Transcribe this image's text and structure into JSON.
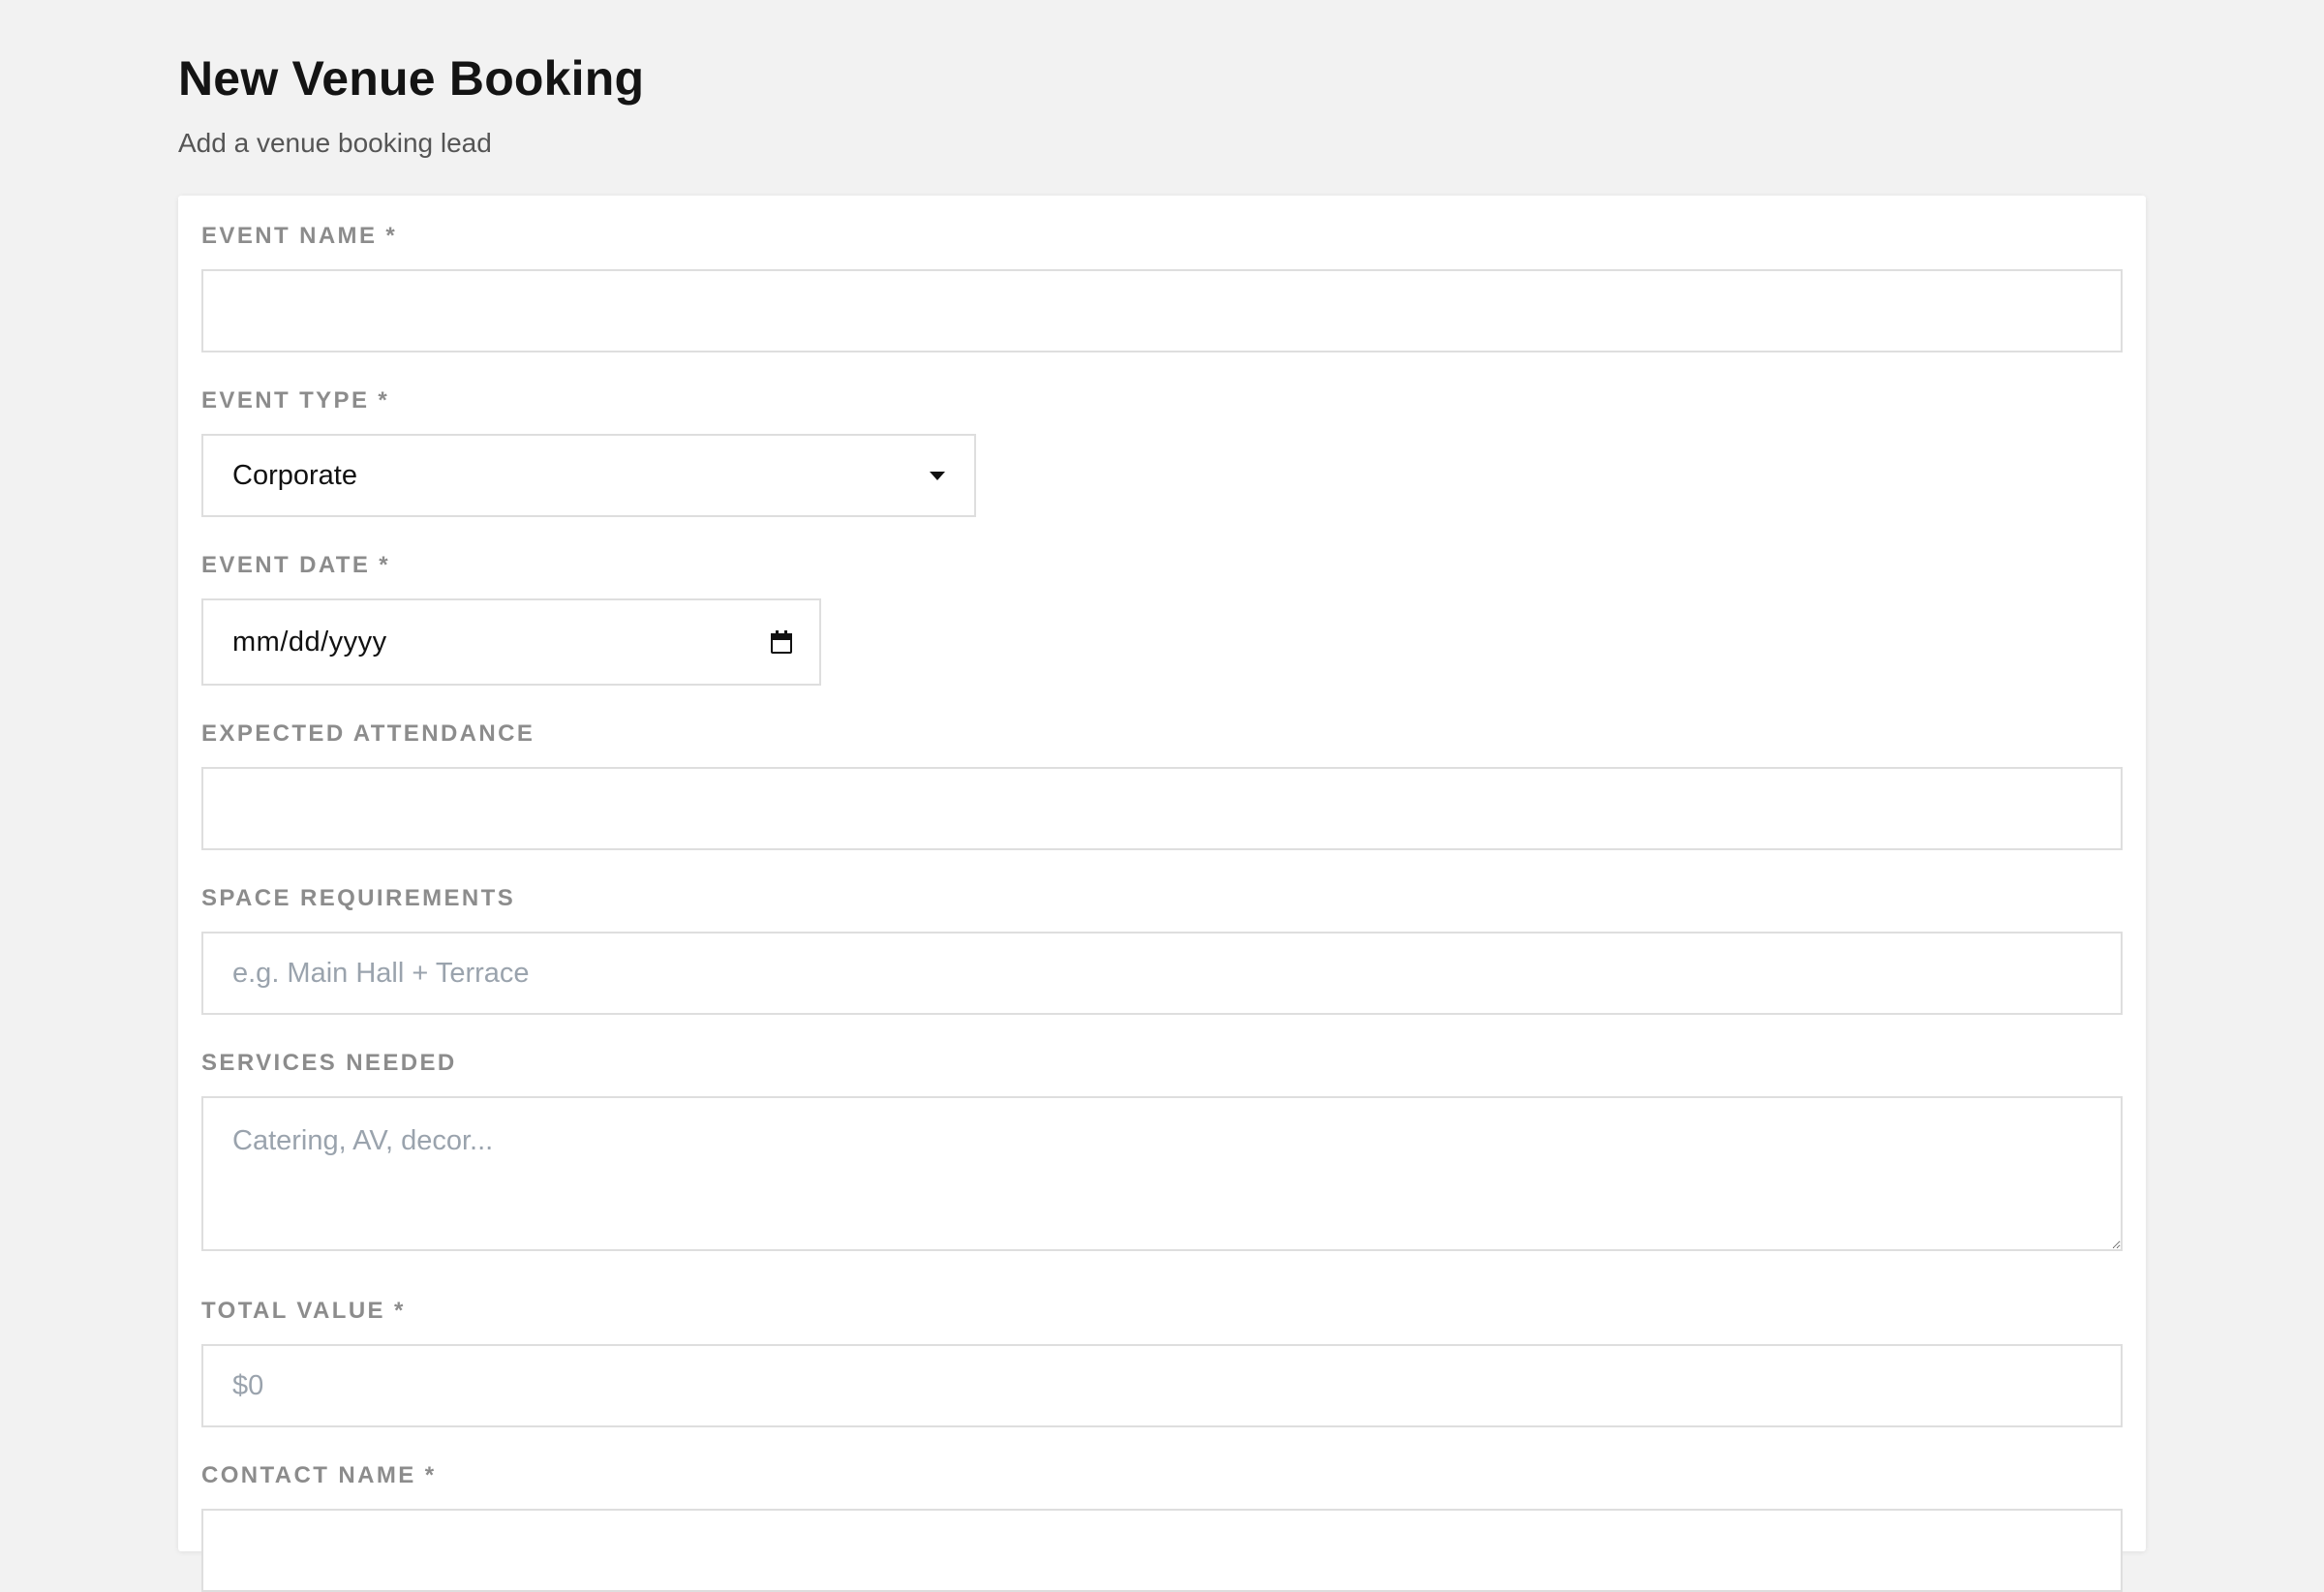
{
  "header": {
    "title": "New Venue Booking",
    "subtitle": "Add a venue booking lead"
  },
  "form": {
    "event_name": {
      "label": "EVENT NAME *",
      "value": "",
      "placeholder": ""
    },
    "event_type": {
      "label": "EVENT TYPE *",
      "selected": "Corporate"
    },
    "event_date": {
      "label": "EVENT DATE *",
      "value": "mm/dd/yyyy"
    },
    "expected_attendance": {
      "label": "EXPECTED ATTENDANCE",
      "value": "",
      "placeholder": ""
    },
    "space_requirements": {
      "label": "SPACE REQUIREMENTS",
      "value": "",
      "placeholder": "e.g. Main Hall + Terrace"
    },
    "services_needed": {
      "label": "SERVICES NEEDED",
      "value": "",
      "placeholder": "Catering, AV, decor..."
    },
    "total_value": {
      "label": "TOTAL VALUE *",
      "value": "",
      "placeholder": "$0"
    },
    "contact_name": {
      "label": "CONTACT NAME *",
      "value": "",
      "placeholder": ""
    }
  },
  "icons": {
    "select_caret": "chevron-down-icon",
    "date_picker": "calendar-icon"
  },
  "colors": {
    "background": "#f2f2f2",
    "card": "#ffffff",
    "label": "#8c8c8c",
    "border": "#dedede",
    "placeholder": "#9aa3ad"
  }
}
